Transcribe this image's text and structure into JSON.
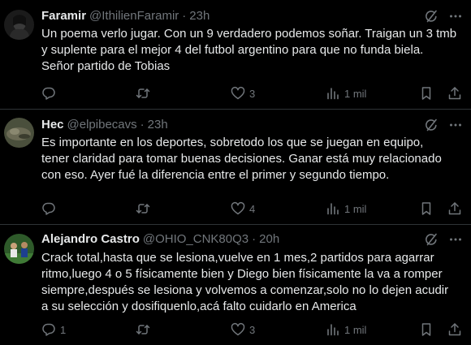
{
  "colors": {
    "background": "#000000",
    "text": "#e7e9ea",
    "muted": "#71767b",
    "divider": "#2f3336"
  },
  "tweets": [
    {
      "name": "Faramir",
      "handle": "@IthilienFaramir",
      "separator": "·",
      "time": "23h",
      "lines": [
        "Un poema verlo jugar. Con un 9 verdadero podemos soñar. Traigan un 3 tmb",
        "y suplente para el mejor 4 del futbol argentino para que no funda biela.",
        "Señor partido de Tobias"
      ],
      "replies": "",
      "retweets": "",
      "likes": "3",
      "views": "1 mil",
      "icons": [
        "grok-icon",
        "more-icon",
        "reply-icon",
        "retweet-icon",
        "like-icon",
        "views-icon",
        "bookmark-icon",
        "share-icon"
      ]
    },
    {
      "name": "Hec",
      "handle": "@elpibecavs",
      "separator": "·",
      "time": "23h",
      "lines": [
        "Es importante en los deportes, sobretodo los que se juegan en equipo,",
        "tener claridad para tomar buenas decisiones. Ganar está muy relacionado",
        "con eso. Ayer fué la diferencia entre el primer y segundo tiempo."
      ],
      "replies": "",
      "retweets": "",
      "likes": "4",
      "views": "1 mil",
      "icons": [
        "grok-icon",
        "more-icon",
        "reply-icon",
        "retweet-icon",
        "like-icon",
        "views-icon",
        "bookmark-icon",
        "share-icon"
      ]
    },
    {
      "name": "Alejandro Castro",
      "handle": "@OHIO_CNK80Q3",
      "separator": "·",
      "time": "20h",
      "lines": [
        "Crack total,hasta que se lesiona,vuelve en 1 mes,2 partidos para agarrar",
        "ritmo,luego 4 o 5 físicamente bien y Diego bien físicamente la va a romper",
        "siempre,después se lesiona y volvemos a comenzar,solo no lo dejen acudir",
        "a su selección y dosifiquenlo,acá falto cuidarlo en America"
      ],
      "replies": "1",
      "retweets": "",
      "likes": "3",
      "views": "1 mil",
      "icons": [
        "grok-icon",
        "more-icon",
        "reply-icon",
        "retweet-icon",
        "like-icon",
        "views-icon",
        "bookmark-icon",
        "share-icon"
      ]
    }
  ]
}
